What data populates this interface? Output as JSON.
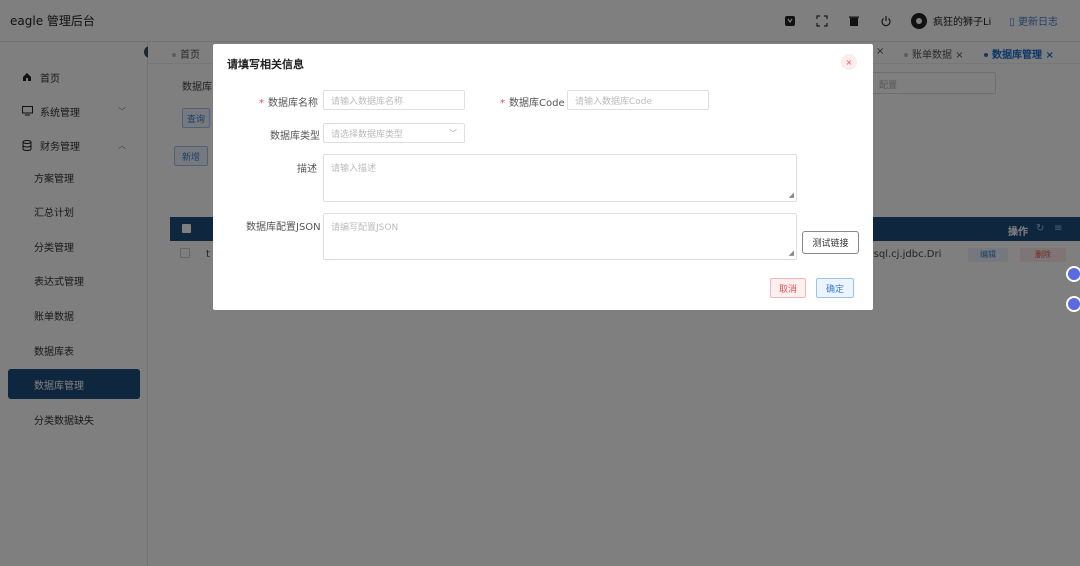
{
  "app": {
    "title": "eagle 管理后台"
  },
  "header": {
    "icons": [
      "github-icon",
      "fullscreen-icon",
      "trash-icon",
      "power-icon"
    ],
    "username": "疯狂的狮子Li",
    "changelog": "更新日志"
  },
  "sidebar": {
    "items": [
      {
        "label": "首页",
        "icon": "home-icon"
      },
      {
        "label": "系统管理",
        "icon": "monitor-icon",
        "arrow": "﹀"
      },
      {
        "label": "财务管理",
        "icon": "database-icon",
        "arrow": "︿"
      },
      {
        "label": "方案管理"
      },
      {
        "label": "汇总计划"
      },
      {
        "label": "分类管理"
      },
      {
        "label": "表达式管理"
      },
      {
        "label": "账单数据"
      },
      {
        "label": "数据库表"
      },
      {
        "label": "数据库管理"
      },
      {
        "label": "分类数据缺失"
      }
    ]
  },
  "tabs": {
    "home": "首页",
    "bill": "账单数据",
    "db": "数据库管理",
    "close": "×"
  },
  "background": {
    "search_label": "数据库",
    "config_placeholder": "配置",
    "query_btn": "查询",
    "add_btn": "新增",
    "ops_header": "操作",
    "row_first": "t",
    "row_driver": "mysql.cj.jdbc.Dri",
    "edit": "编辑",
    "delete": "删除"
  },
  "dialog": {
    "title": "请填写相关信息",
    "close": "×",
    "required_mark": "*",
    "name_label": "数据库名称",
    "name_placeholder": "请输入数据库名称",
    "code_label": "数据库Code",
    "code_placeholder": "请输入数据库Code",
    "type_label": "数据库类型",
    "type_placeholder": "请选择数据库类型",
    "desc_label": "描述",
    "desc_placeholder": "请输入描述",
    "json_label": "数据库配置JSON",
    "json_placeholder": "请编写配置JSON",
    "test_btn": "测试链接",
    "cancel_btn": "取消",
    "confirm_btn": "确定"
  },
  "colors": {
    "primary": "#1c4f7c",
    "link": "#3a7ecf",
    "danger": "#e05555"
  }
}
